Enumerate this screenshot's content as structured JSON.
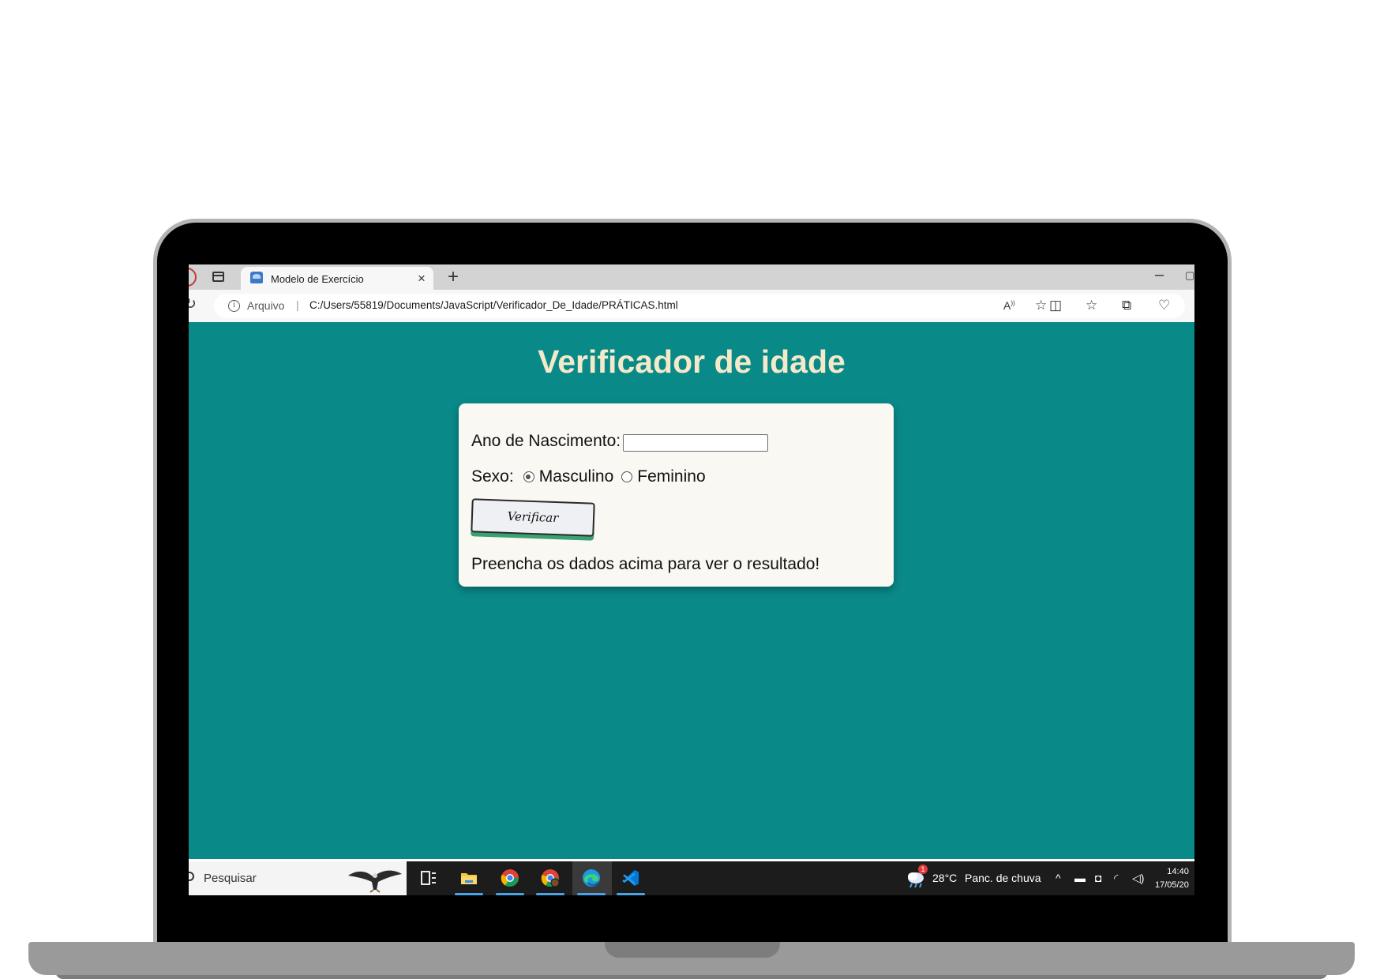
{
  "browser": {
    "tab_title": "Modelo de Exercício",
    "tab_close": "×",
    "new_tab": "+",
    "minimize": "–",
    "url_protocol": "Arquivo",
    "url_separator": "|",
    "url": "C:/Users/55819/Documents/JavaScript/Verificador_De_Idade/PRÁTICAS.html"
  },
  "page": {
    "title": "Verificador de idade",
    "year_label": "Ano de Nascimento:",
    "year_value": "",
    "sex_label": "Sexo:",
    "sex_options": [
      {
        "label": "Masculino",
        "checked": true
      },
      {
        "label": "Feminino",
        "checked": false
      }
    ],
    "verify_button": "Verificar",
    "result_text": "Preencha os dados acima para ver o resultado!"
  },
  "taskbar": {
    "search_placeholder": "Pesquisar",
    "apps": [
      "task-view-icon",
      "file-explorer-icon",
      "chrome-icon",
      "chrome-profile-icon",
      "edge-icon",
      "vscode-icon"
    ],
    "weather_badge": "1",
    "weather_temp": "28°C",
    "weather_desc": "Panc. de chuva",
    "time": "14:40",
    "date": "17/05/20"
  },
  "colors": {
    "page_bg": "#0a8989",
    "title": "#f4e9c8",
    "card_bg": "#faf8f3",
    "button_shadow": "#3aa272"
  }
}
